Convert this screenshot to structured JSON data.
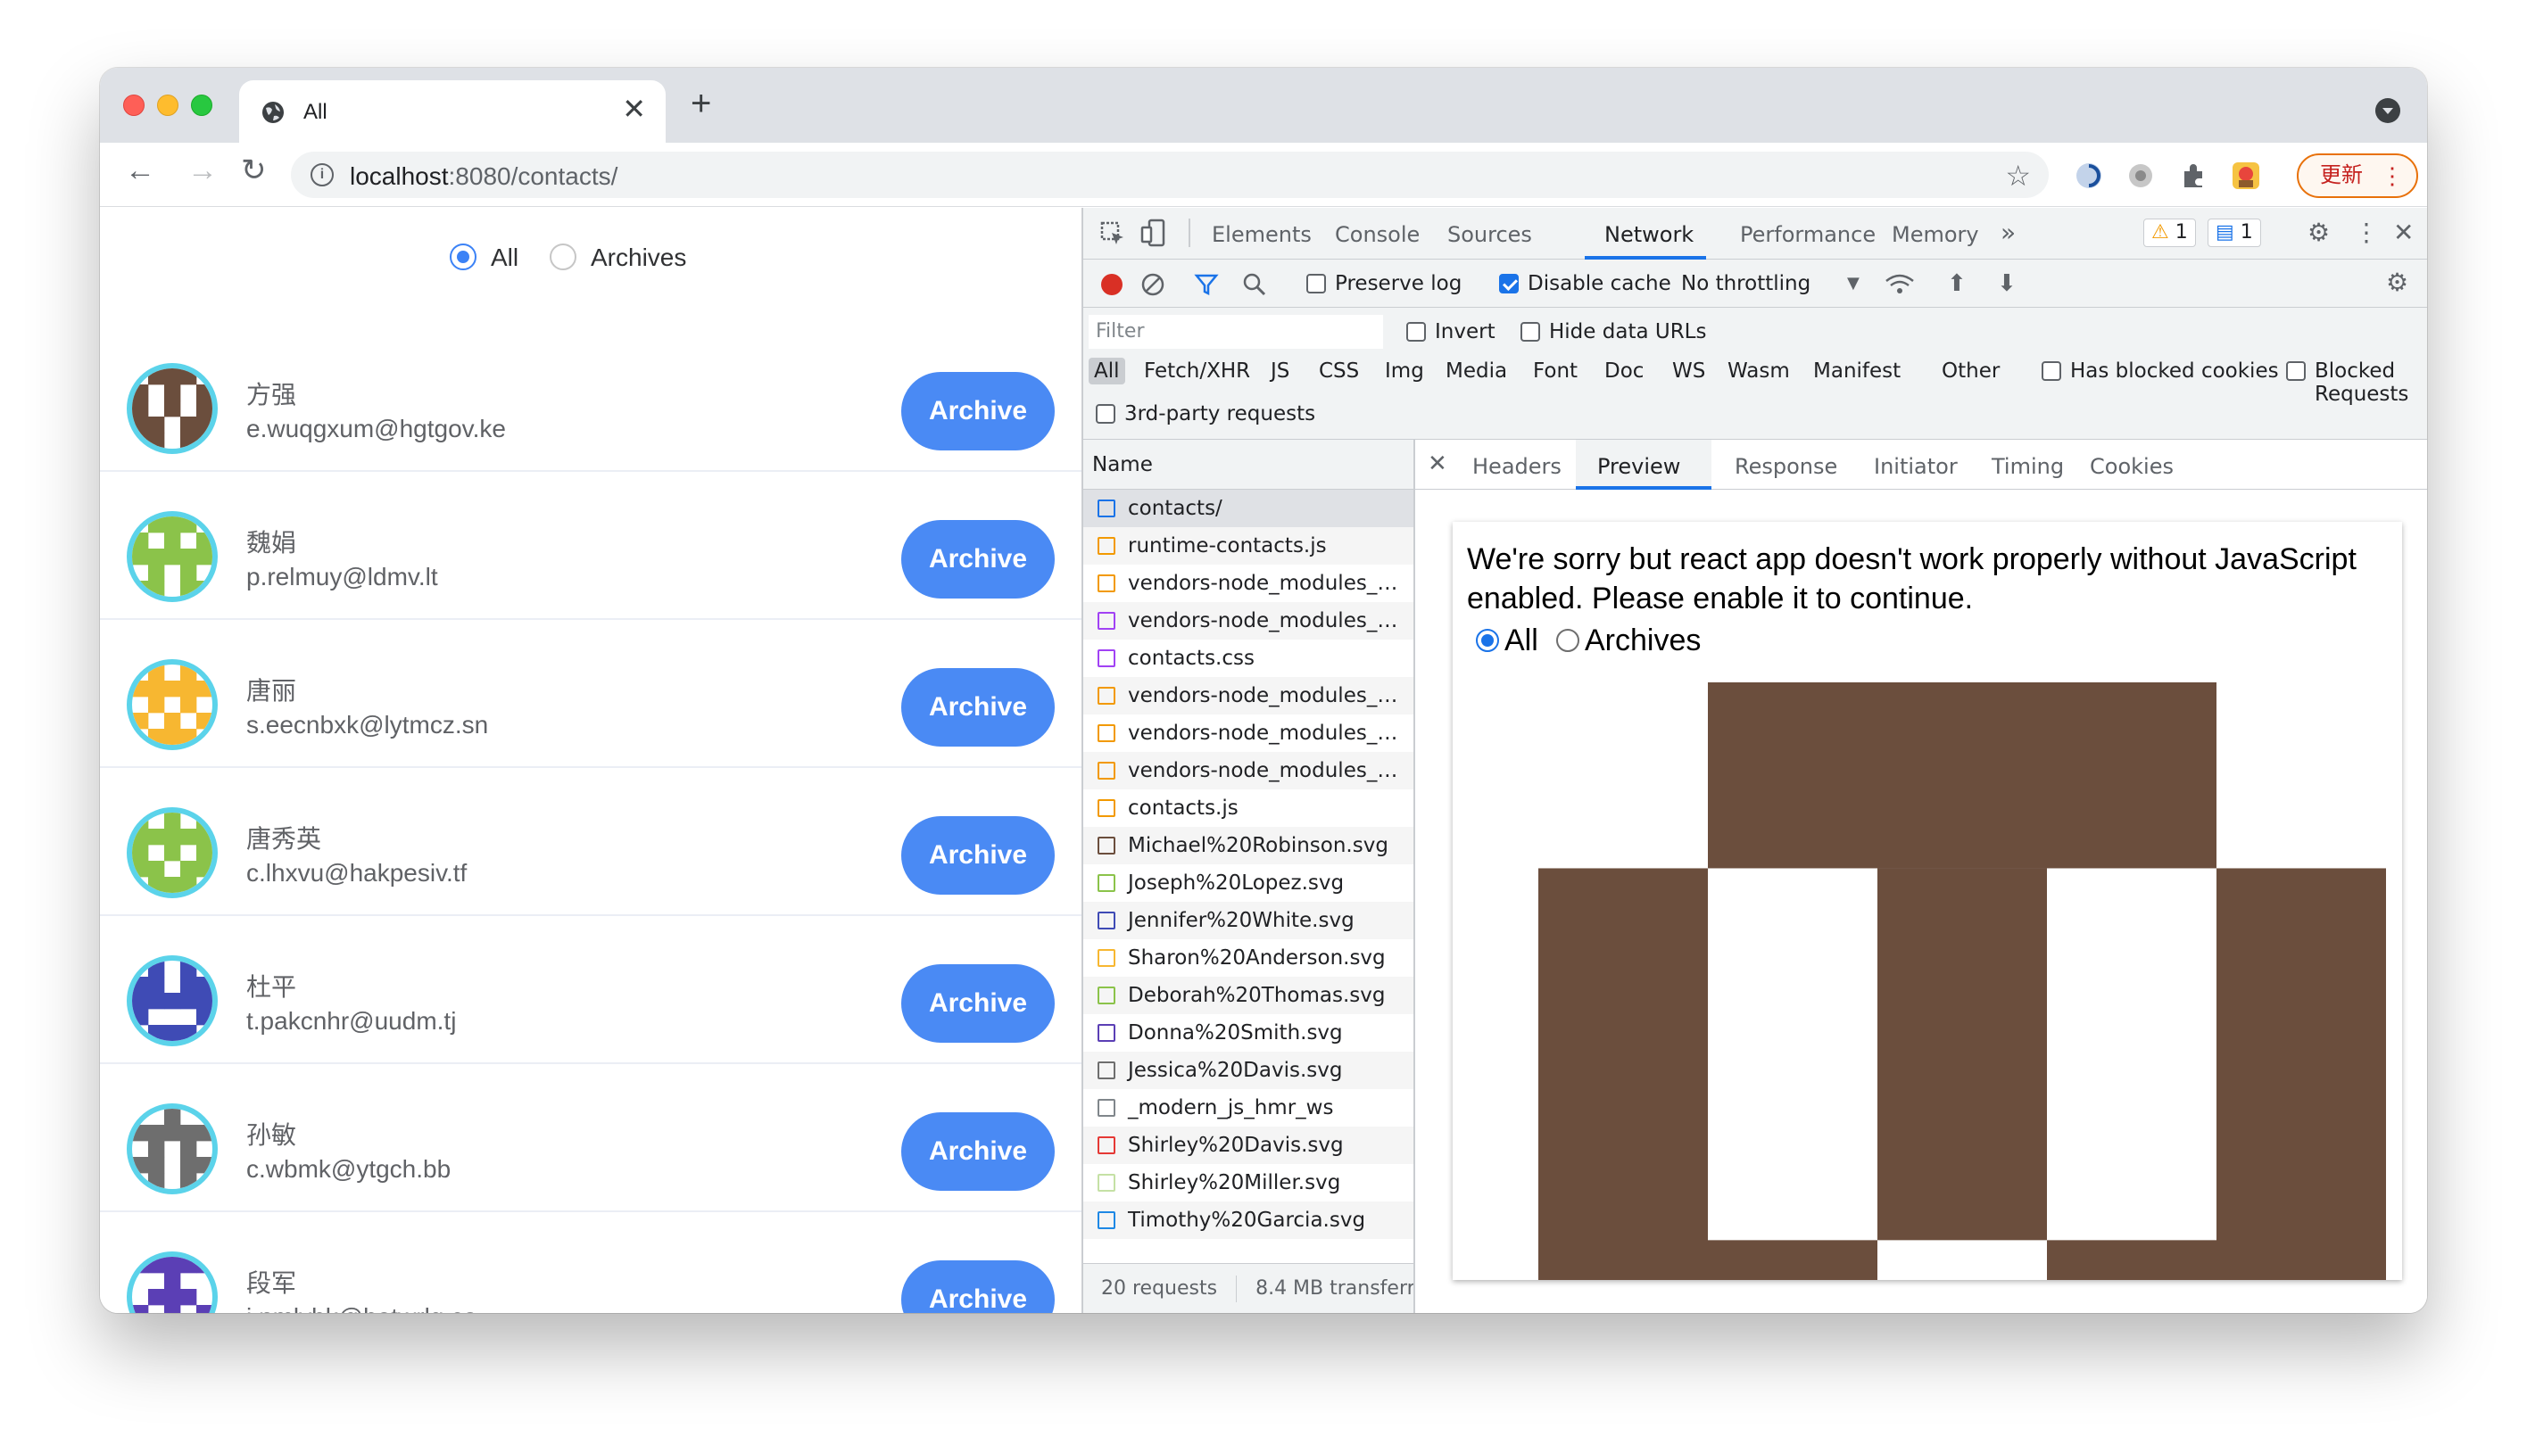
{
  "browser": {
    "tab_title": "All",
    "close_glyph": "✕",
    "new_tab_glyph": "+",
    "url_host": "localhost",
    "url_path": ":8080/contacts/",
    "update_label": "更新",
    "update_menu_glyph": "⋮",
    "back_glyph": "←",
    "forward_glyph": "→",
    "reload_glyph": "↻",
    "star_glyph": "☆",
    "info_glyph": "i"
  },
  "app": {
    "filter_all": "All",
    "filter_archives": "Archives",
    "selected_filter": "All",
    "archive_label": "Archive",
    "contacts": [
      {
        "name": "方强",
        "email": "e.wuqgxum@hgtgov.ke",
        "color": "#6b4e3d"
      },
      {
        "name": "魏娟",
        "email": "p.relmuy@ldmv.lt",
        "color": "#8bc34a"
      },
      {
        "name": "唐丽",
        "email": "s.eecnbxk@lytmcz.sn",
        "color": "#f7b731"
      },
      {
        "name": "唐秀英",
        "email": "c.lhxvu@hakpesiv.tf",
        "color": "#8bc34a"
      },
      {
        "name": "杜平",
        "email": "t.pakcnhr@uudm.tj",
        "color": "#3f4bb5"
      },
      {
        "name": "孙敏",
        "email": "c.wbmk@ytgch.bb",
        "color": "#6e6e6e"
      },
      {
        "name": "段军",
        "email": "j.nmlybk@botwrlq.ca",
        "color": "#5b3fb5"
      }
    ]
  },
  "devtools": {
    "tabs": [
      "Elements",
      "Console",
      "Sources",
      "Network",
      "Performance",
      "Memory"
    ],
    "active_tab": "Network",
    "more_tabs_glyph": "»",
    "warnings_count": "1",
    "messages_count": "1",
    "warning_glyph": "⚠",
    "message_glyph": "▤",
    "gear_glyph": "⚙",
    "kebab_glyph": "⋮",
    "close_glyph": "✕",
    "preserve_log": "Preserve log",
    "disable_cache": "Disable cache",
    "throttling": "No throttling",
    "dropdown_glyph": "▼",
    "upload_glyph": "⬆",
    "download_glyph": "⬇",
    "filter_placeholder": "Filter",
    "invert": "Invert",
    "hide_data_urls": "Hide data URLs",
    "types": [
      "All",
      "Fetch/XHR",
      "JS",
      "CSS",
      "Img",
      "Media",
      "Font",
      "Doc",
      "WS",
      "Wasm",
      "Manifest",
      "Other"
    ],
    "has_blocked_cookies": "Has blocked cookies",
    "blocked_requests": "Blocked Requests",
    "third_party": "3rd-party requests",
    "name_header": "Name",
    "requests": [
      {
        "name": "contacts/",
        "icon_color": "#1a73e8"
      },
      {
        "name": "runtime-contacts.js",
        "icon_color": "#f29900"
      },
      {
        "name": "vendors-node_modules_…",
        "icon_color": "#f29900"
      },
      {
        "name": "vendors-node_modules_…",
        "icon_color": "#a142f4"
      },
      {
        "name": "contacts.css",
        "icon_color": "#a142f4"
      },
      {
        "name": "vendors-node_modules_…",
        "icon_color": "#f29900"
      },
      {
        "name": "vendors-node_modules_…",
        "icon_color": "#f29900"
      },
      {
        "name": "vendors-node_modules_…",
        "icon_color": "#f29900"
      },
      {
        "name": "contacts.js",
        "icon_color": "#f29900"
      },
      {
        "name": "Michael%20Robinson.svg",
        "icon_color": "#6b4e3d"
      },
      {
        "name": "Joseph%20Lopez.svg",
        "icon_color": "#8bc34a"
      },
      {
        "name": "Jennifer%20White.svg",
        "icon_color": "#3f4bb5"
      },
      {
        "name": "Sharon%20Anderson.svg",
        "icon_color": "#f7b731"
      },
      {
        "name": "Deborah%20Thomas.svg",
        "icon_color": "#8bc34a"
      },
      {
        "name": "Donna%20Smith.svg",
        "icon_color": "#5b3fb5"
      },
      {
        "name": "Jessica%20Davis.svg",
        "icon_color": "#6e6e6e"
      },
      {
        "name": "_modern_js_hmr_ws",
        "icon_color": "#80868b"
      },
      {
        "name": "Shirley%20Davis.svg",
        "icon_color": "#e53935"
      },
      {
        "name": "Shirley%20Miller.svg",
        "icon_color": "#c5e1a5"
      },
      {
        "name": "Timothy%20Garcia.svg",
        "icon_color": "#1e88e5"
      }
    ],
    "footer_requests": "20 requests",
    "footer_transfer": "8.4 MB transferr",
    "preview_tabs": [
      "Headers",
      "Preview",
      "Response",
      "Initiator",
      "Timing",
      "Cookies"
    ],
    "active_preview_tab": "Preview",
    "preview_message": "We're sorry but react app doesn't work properly without JavaScript enabled. Please enable it to continue.",
    "preview_all": "All",
    "preview_archives": "Archives",
    "preview_avatar_color": "#6b4e3d"
  }
}
